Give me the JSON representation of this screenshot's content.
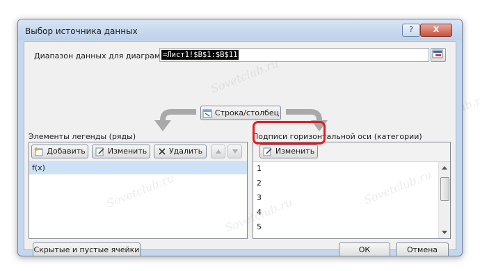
{
  "window": {
    "title": "Выбор источника данных",
    "help_glyph": "?",
    "close_glyph": "X"
  },
  "range": {
    "label": "Диапазон данных для диаграммы:",
    "value": "=Лист1!$B$1:$B$11"
  },
  "switch_button": {
    "label": "Строка/столбец"
  },
  "legend_group": {
    "label": "Элементы легенды (ряды)",
    "add_label": "Добавить",
    "edit_label": "Изменить",
    "delete_label": "Удалить",
    "series": [
      "f(x)"
    ]
  },
  "axis_group": {
    "label": "Подписи горизонтальной оси (категории)",
    "edit_label": "Изменить",
    "categories": [
      "1",
      "2",
      "3",
      "4",
      "5"
    ]
  },
  "footer": {
    "hidden_cells_label": "Скрытые и пустые ячейки",
    "ok_label": "ОК",
    "cancel_label": "Отмена"
  },
  "watermark": {
    "text": "Sovetclub.ru"
  },
  "colors": {
    "highlight": "#e41b23",
    "selection": "#cde2f6",
    "titlebar": "#c5d7ec"
  }
}
